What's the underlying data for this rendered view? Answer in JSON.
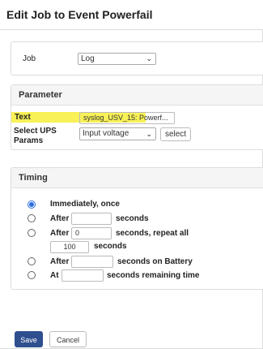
{
  "dialog": {
    "title": "Edit Job to Event Powerfail"
  },
  "job": {
    "label": "Job",
    "value": "Log"
  },
  "parameter": {
    "heading": "Parameter",
    "text_label": "Text",
    "text_value": "syslog_USV_15: Powerf...",
    "ups_label_line1": "Select UPS",
    "ups_label_line2": "Params",
    "ups_select_value": "Input voltage",
    "select_button": "select",
    "highlight_color": "#f7ef3a"
  },
  "timing": {
    "heading": "Timing",
    "options": [
      {
        "label": "Immediately, once",
        "selected": true
      },
      {
        "prefix": "After",
        "value": "",
        "suffix": "seconds",
        "selected": false
      },
      {
        "prefix": "After",
        "value": "0",
        "suffix": "seconds, repeat all",
        "selected": false
      },
      {
        "repeat_value": "100",
        "repeat_suffix": "seconds"
      },
      {
        "prefix": "After",
        "value": "",
        "suffix": "seconds on Battery",
        "selected": false
      },
      {
        "prefix": "At",
        "value": "",
        "suffix": "seconds remaining time",
        "selected": false
      }
    ]
  },
  "footer": {
    "save": "Save",
    "cancel": "Cancel",
    "save_color": "#2f4f8f"
  }
}
